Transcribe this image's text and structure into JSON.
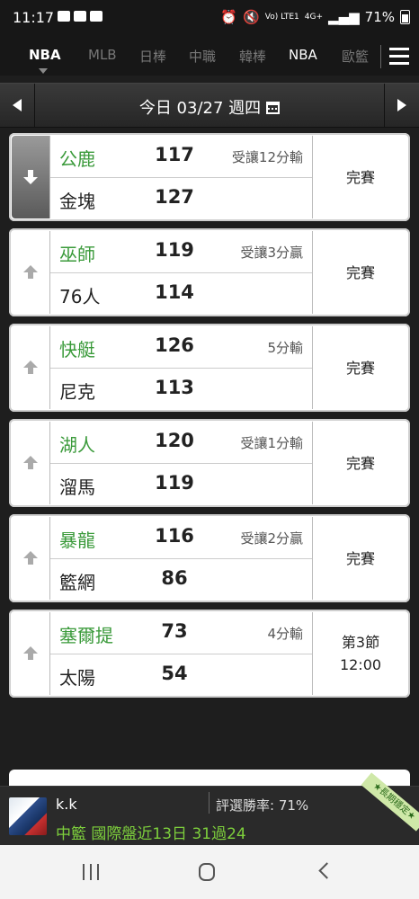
{
  "status_bar": {
    "time": "11:17",
    "battery": "71%",
    "network": "4G+",
    "volte": "Vo) LTE1"
  },
  "tabs": [
    {
      "label": "NBA",
      "active": true
    },
    {
      "label": "MLB",
      "active": false
    },
    {
      "label": "日棒",
      "active": false
    },
    {
      "label": "中職",
      "active": false
    },
    {
      "label": "韓棒",
      "active": false
    },
    {
      "label": "NBA",
      "active": false
    },
    {
      "label": "歐籃",
      "active": false
    }
  ],
  "date_bar": {
    "date": "今日 03/27 週四"
  },
  "games": [
    {
      "home": "公鹿",
      "home_score": "117",
      "away": "金塊",
      "away_score": "127",
      "spread": "受讓12分輸",
      "status": "完賽",
      "expanded": true
    },
    {
      "home": "巫師",
      "home_score": "119",
      "away": "76人",
      "away_score": "114",
      "spread": "受讓3分贏",
      "status": "完賽",
      "expanded": false
    },
    {
      "home": "快艇",
      "home_score": "126",
      "away": "尼克",
      "away_score": "113",
      "spread": "5分輸",
      "status": "完賽",
      "expanded": false
    },
    {
      "home": "湖人",
      "home_score": "120",
      "away": "溜馬",
      "away_score": "119",
      "spread": "受讓1分輸",
      "status": "完賽",
      "expanded": false
    },
    {
      "home": "暴龍",
      "home_score": "116",
      "away": "籃網",
      "away_score": "86",
      "spread": "受讓2分贏",
      "status": "完賽",
      "expanded": false
    },
    {
      "home": "塞爾提",
      "home_score": "73",
      "away": "太陽",
      "away_score": "54",
      "spread": "4分輸",
      "status": "第3節\n12:00",
      "expanded": false
    }
  ],
  "banner": {
    "username": "k.k",
    "win_rate": "評選勝率: 71%",
    "record": "中籃 國際盤近13日 31過24",
    "ribbon": "★長期穩定★"
  },
  "colors": {
    "team_green": "#3a9a3a",
    "record_green": "#7dcf3c"
  }
}
